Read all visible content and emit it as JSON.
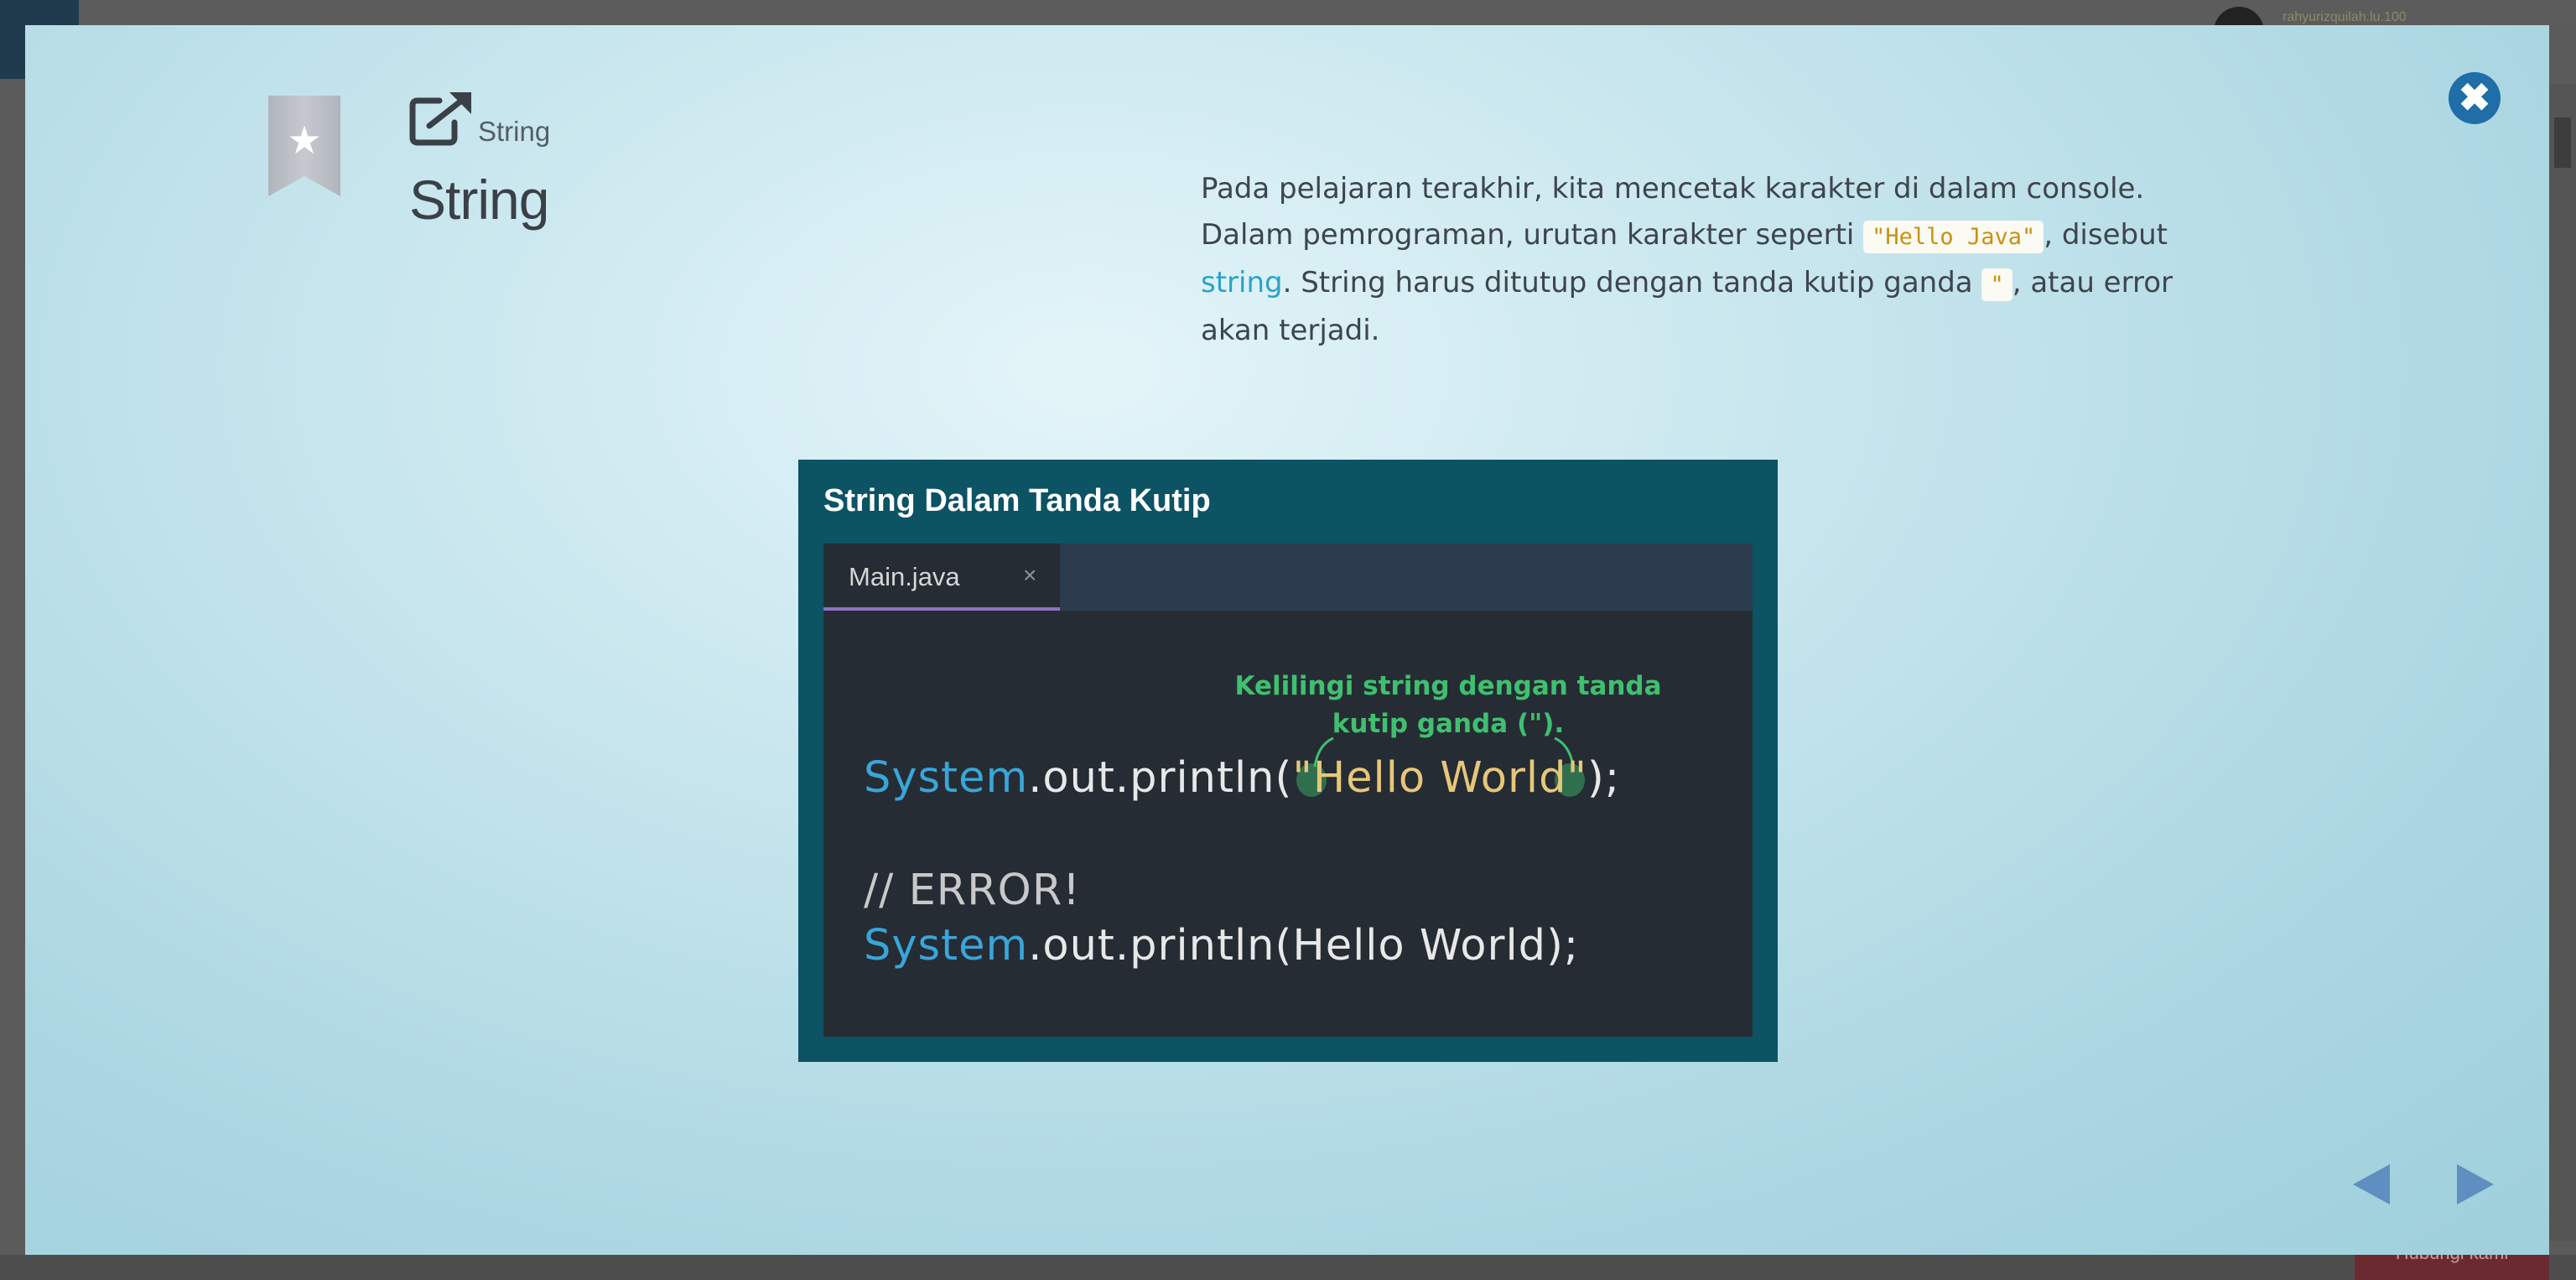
{
  "background": {
    "username": "rahyurizquilah.lu.100",
    "feedback_button": "Hubungi kami"
  },
  "header": {
    "breadcrumb": "String",
    "title": "String"
  },
  "lesson": {
    "line1": "Pada pelajaran terakhir, kita mencetak karakter di dalam console.",
    "line2_pre": "Dalam pemrograman, urutan karakter seperti ",
    "code_example": "\"Hello Java\"",
    "line2_post": ", disebut",
    "term": "string",
    "line3_mid": ". String harus ditutup dengan tanda kutip ganda ",
    "quote_char": "\"",
    "line3_post": ", atau error",
    "line4": "akan terjadi."
  },
  "figure": {
    "title": "String Dalam Tanda Kutip",
    "tab_label": "Main.java",
    "tab_close": "×",
    "note": "Kelilingi string dengan tanda kutip ganda (\").",
    "code1_kw": "System",
    "code1_a": ".out.println(",
    "code1_str": "\"Hello World\"",
    "code1_b": ");",
    "comment": "// ERROR!",
    "code2_kw": "System",
    "code2_rest": ".out.println(Hello World);"
  },
  "controls": {
    "close": "✖",
    "star": "★"
  },
  "colors": {
    "accent": "#1f6ea8",
    "string_code": "#c8920e",
    "term": "#2aa3c6",
    "note_green": "#3fc06f",
    "figure_bg": "#0c5364"
  },
  "icons": [
    "bookmark-icon",
    "star-icon",
    "external-link-icon",
    "close-icon",
    "arrow-left-icon",
    "arrow-right-icon"
  ]
}
